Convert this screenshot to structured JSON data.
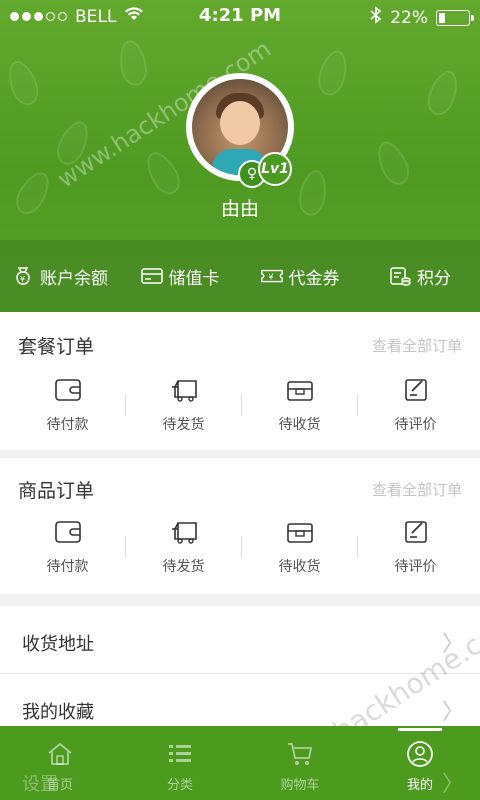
{
  "status_bar": {
    "carrier": "BELL",
    "time": "4:21 PM",
    "battery": "22%",
    "battery_level": 0.22
  },
  "profile": {
    "username": "由由",
    "level_badge": "Lv1"
  },
  "quick_actions": [
    {
      "label": "账户余额",
      "icon": "money-bag-icon"
    },
    {
      "label": "储值卡",
      "icon": "card-icon"
    },
    {
      "label": "代金券",
      "icon": "voucher-icon"
    },
    {
      "label": "积分",
      "icon": "points-icon"
    }
  ],
  "package_orders": {
    "title": "套餐订单",
    "view_all": "查看全部订单",
    "items": [
      "待付款",
      "待发货",
      "待收货",
      "待评价"
    ]
  },
  "product_orders": {
    "title": "商品订单",
    "view_all": "查看全部订单",
    "items": [
      "待付款",
      "待发货",
      "待收货",
      "待评价"
    ]
  },
  "list": [
    {
      "label": "收货地址"
    },
    {
      "label": "我的收藏"
    },
    {
      "label": "设置"
    }
  ],
  "tabbar": [
    {
      "label": "首页",
      "icon": "home-icon"
    },
    {
      "label": "分类",
      "icon": "list-icon"
    },
    {
      "label": "购物车",
      "icon": "cart-icon"
    },
    {
      "label": "我的",
      "icon": "user-icon"
    }
  ],
  "watermark": "www.hackhome.com",
  "colors": {
    "brand_green": "#4c9a1e",
    "muted_gray": "#c4c4c4"
  }
}
